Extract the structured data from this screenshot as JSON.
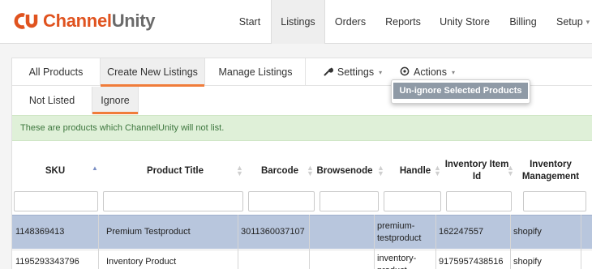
{
  "brand": {
    "name_part1": "Channel",
    "name_part2": "Unity"
  },
  "nav": {
    "items": [
      {
        "label": "Start"
      },
      {
        "label": "Listings"
      },
      {
        "label": "Orders"
      },
      {
        "label": "Reports"
      },
      {
        "label": "Unity Store"
      },
      {
        "label": "Billing"
      },
      {
        "label": "Setup"
      }
    ]
  },
  "tabs": {
    "all_products": "All Products",
    "create_new_listings": "Create New Listings",
    "manage_listings": "Manage Listings",
    "settings": "Settings",
    "actions": "Actions"
  },
  "subtabs": {
    "not_listed": "Not Listed",
    "ignore": "Ignore"
  },
  "actions_menu": {
    "unignore": "Un-ignore Selected Products"
  },
  "notice": "These are products which ChannelUnity will not list.",
  "table": {
    "headers": {
      "sku": "SKU",
      "title": "Product Title",
      "barcode": "Barcode",
      "browsenode": "Browsenode",
      "handle": "Handle",
      "inventory_item_id": "Inventory Item Id",
      "inventory_management": "Inventory Management"
    },
    "rows": [
      {
        "sku": "1148369413",
        "title": "Premium Testproduct",
        "barcode": "3011360037107",
        "browsenode": "",
        "handle": "premium-testproduct",
        "inventory_item_id": "162247557",
        "inventory_management": "shopify"
      },
      {
        "sku": "1195293343796",
        "title": "Inventory Product",
        "barcode": "",
        "browsenode": "",
        "handle": "inventory-product",
        "inventory_item_id": "9175957438516",
        "inventory_management": "shopify"
      }
    ]
  },
  "colors": {
    "accent_orange": "#f07c3a",
    "brand_orange": "#e0531f",
    "selected_row": "#b8c6dd",
    "notice_bg": "#dff0d8"
  }
}
